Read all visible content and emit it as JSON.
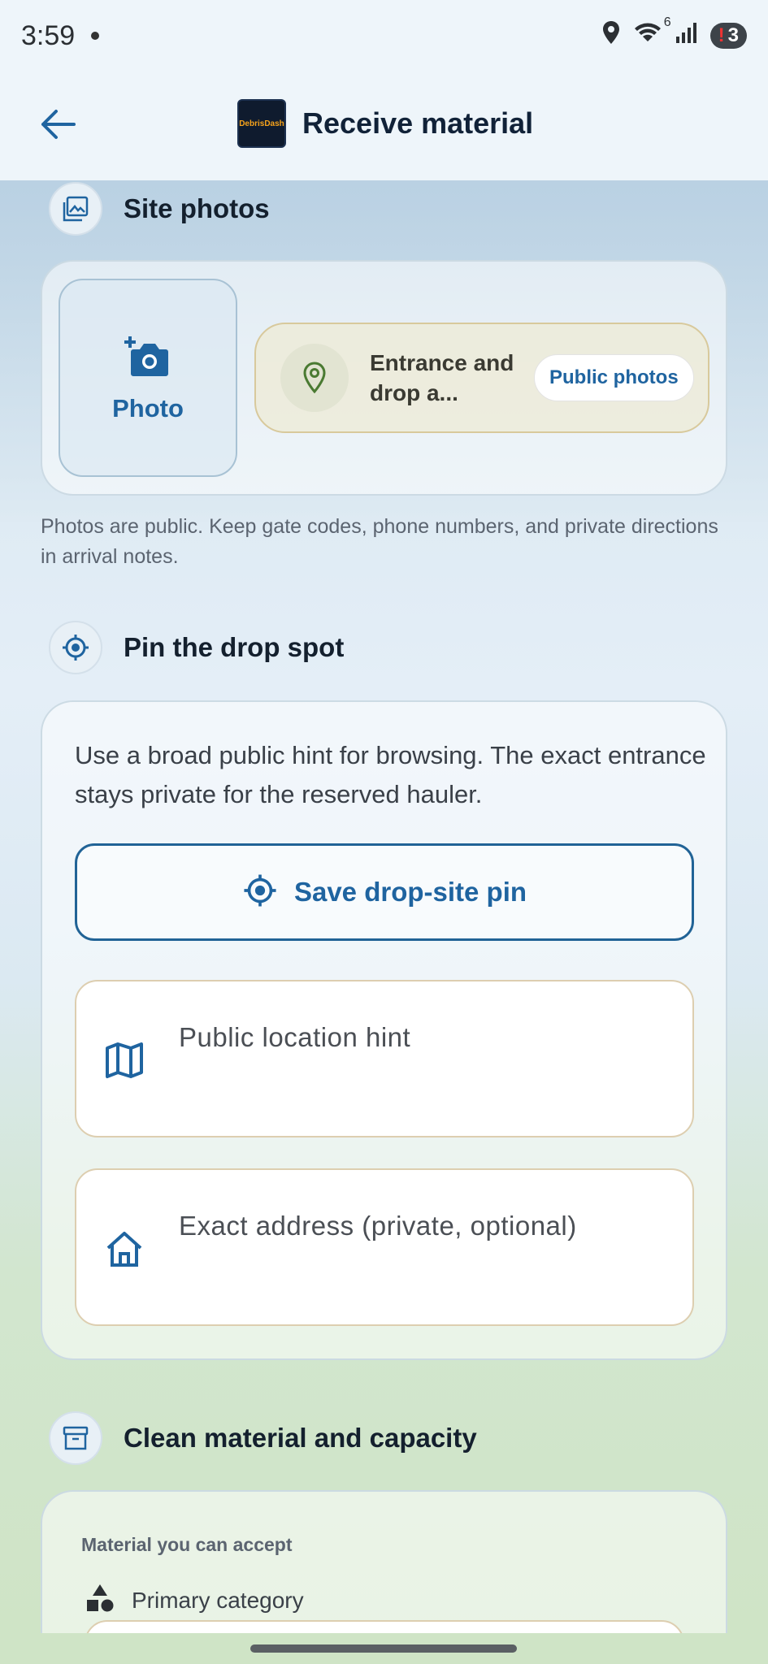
{
  "status_bar": {
    "time": "3:59",
    "wifi_badge": "6",
    "notification_count": "3",
    "notification_mark": "!"
  },
  "app_bar": {
    "title": "Receive material",
    "logo_text": "DebrisDash"
  },
  "site_photos": {
    "title": "Site photos",
    "photo_button_label": "Photo",
    "location_chip_text": "Entrance and drop a...",
    "public_photos_label": "Public photos",
    "note": "Photos are public. Keep gate codes, phone numbers, and private directions in arrival notes."
  },
  "pin": {
    "title": "Pin the drop spot",
    "description": "Use a broad public hint for browsing. The exact entrance stays private for the reserved hauler.",
    "save_button_label": "Save drop-site pin",
    "public_hint_label": "Public location hint",
    "exact_address_label": "Exact address (private, optional)"
  },
  "material": {
    "title": "Clean material and capacity",
    "accept_label": "Material you can accept",
    "primary_category_label": "Primary category"
  },
  "colors": {
    "accent_blue": "#1f64a0",
    "field_border": "#ddceb0",
    "title_navy": "#112238"
  },
  "icons": [
    "arrow-left-icon",
    "image-icon",
    "add-camera-icon",
    "map-pin-icon",
    "target-icon",
    "map-icon",
    "home-icon",
    "archive-icon",
    "shapes-icon"
  ]
}
